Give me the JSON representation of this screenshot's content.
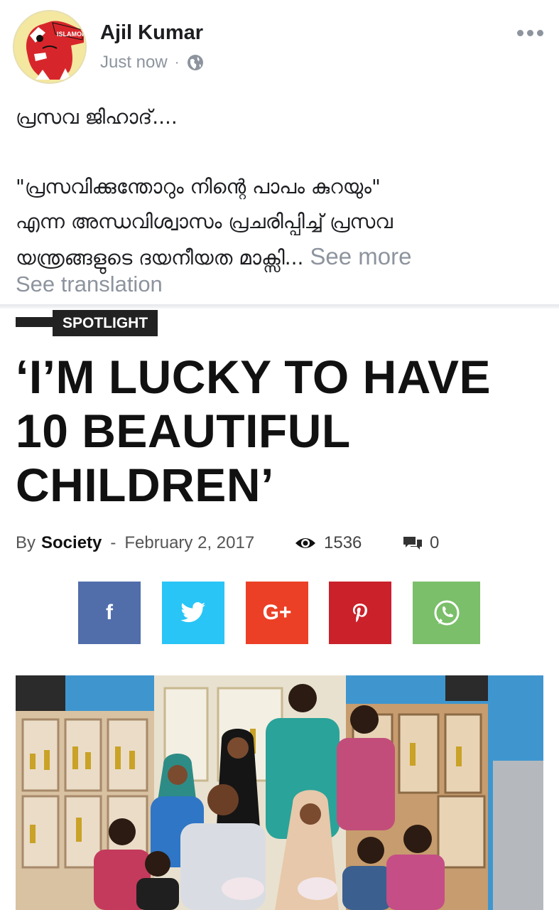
{
  "post": {
    "author": "Ajil Kumar",
    "timestamp": "Just now",
    "separator": "·",
    "audience_icon": "globe-icon",
    "text_line1": "പ്രസവ ജിഹാദ്....",
    "text_line2": "\"പ്രസവിക്കുന്തോറും നിന്റെ പാപം കുറയും\"",
    "text_line3": "എന്ന അന്ധവിശ്വാസം പ്രചരിപ്പിച്ച് പ്രസവ",
    "text_line4": "യന്ത്രങ്ങളുടെ ദയനീയത മാക്സി...",
    "see_more": "See more",
    "see_translation": "See translation",
    "avatar_label": "ISLAMOPH"
  },
  "article": {
    "category": "SPOTLIGHT",
    "headline": "‘I’M LUCKY TO HAVE 10 BEAUTIFUL CHILDREN’",
    "by_prefix": "By",
    "author": "Society",
    "dash": "-",
    "date": "February 2, 2017",
    "views": "1536",
    "comments": "0"
  },
  "share": {
    "facebook": "f",
    "googleplus": "G+",
    "colors": {
      "facebook": "#516eab",
      "twitter": "#29c5f6",
      "googleplus": "#eb4026",
      "pinterest": "#ca212a",
      "whatsapp": "#7bbf6a"
    }
  }
}
